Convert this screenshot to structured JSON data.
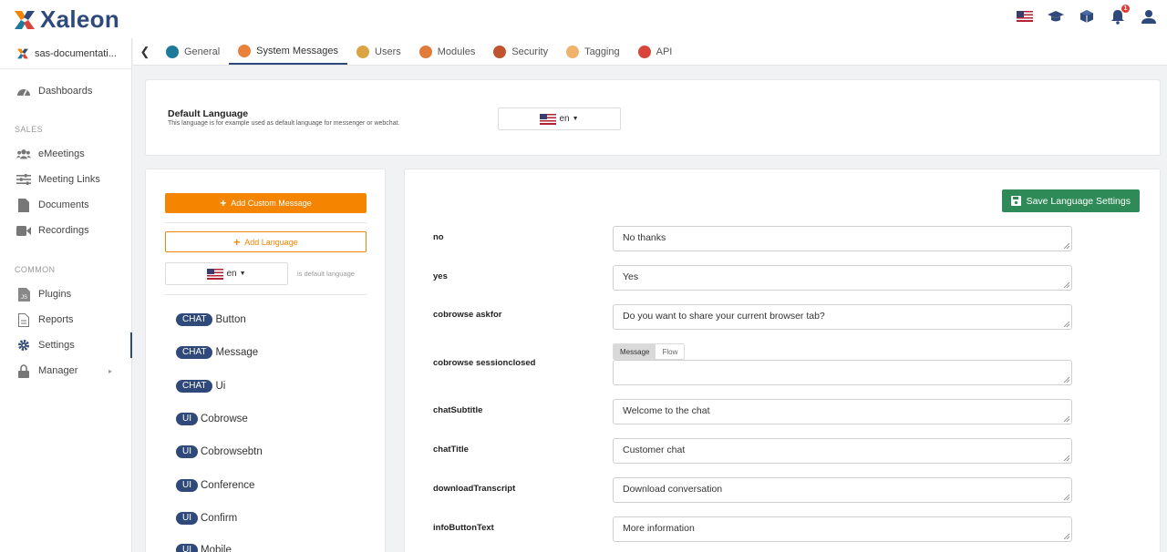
{
  "brand": {
    "name": "Xaleon"
  },
  "topbar": {
    "language_icon": "us-flag-icon",
    "notifications_count": "1"
  },
  "sidebar": {
    "workspace": "sas-documentati...",
    "items": [
      {
        "label": "Dashboards",
        "icon": "dashboard-icon"
      },
      {
        "label": "eMeetings",
        "icon": "users-icon"
      },
      {
        "label": "Meeting Links",
        "icon": "sliders-icon"
      },
      {
        "label": "Documents",
        "icon": "document-icon"
      },
      {
        "label": "Recordings",
        "icon": "video-icon"
      },
      {
        "label": "Plugins",
        "icon": "plugin-icon"
      },
      {
        "label": "Reports",
        "icon": "report-icon"
      },
      {
        "label": "Settings",
        "icon": "gear-icon"
      },
      {
        "label": "Manager",
        "icon": "lock-icon"
      }
    ],
    "sections": {
      "sales": "SALES",
      "common": "COMMON"
    }
  },
  "tabs": [
    {
      "label": "General",
      "color": "#1d7a9a"
    },
    {
      "label": "System Messages",
      "color": "#e8823a"
    },
    {
      "label": "Users",
      "color": "#d9a441"
    },
    {
      "label": "Modules",
      "color": "#e07b39"
    },
    {
      "label": "Security",
      "color": "#c0542f"
    },
    {
      "label": "Tagging",
      "color": "#f0b36b"
    },
    {
      "label": "API",
      "color": "#d8463b"
    }
  ],
  "default_language": {
    "title": "Default Language",
    "description": "This language is for example used as default language for messenger or webchat.",
    "value": "en"
  },
  "left_panel": {
    "add_custom_message": "Add Custom Message",
    "add_language": "Add Language",
    "language_value": "en",
    "default_hint": "is default language",
    "categories": [
      {
        "badge": "CHAT",
        "name": "Button"
      },
      {
        "badge": "CHAT",
        "name": "Message"
      },
      {
        "badge": "CHAT",
        "name": "Ui"
      },
      {
        "badge": "UI",
        "name": "Cobrowse"
      },
      {
        "badge": "UI",
        "name": "Cobrowsebtn"
      },
      {
        "badge": "UI",
        "name": "Conference"
      },
      {
        "badge": "UI",
        "name": "Confirm"
      },
      {
        "badge": "UI",
        "name": "Mobile"
      }
    ]
  },
  "right_panel": {
    "save_label": "Save Language Settings",
    "fields": [
      {
        "key": "no",
        "value": "No thanks"
      },
      {
        "key": "yes",
        "value": "Yes"
      },
      {
        "key": "cobrowse askfor",
        "value": "Do you want to share your current browser tab?"
      },
      {
        "key": "cobrowse sessionclosed",
        "value": ""
      },
      {
        "key": "chatSubtitle",
        "value": "Welcome to the chat"
      },
      {
        "key": "chatTitle",
        "value": "Customer chat"
      },
      {
        "key": "downloadTranscript",
        "value": "Download conversation"
      },
      {
        "key": "infoButtonText",
        "value": "More information"
      }
    ],
    "segment": {
      "message": "Message",
      "flow": "Flow"
    }
  },
  "colors": {
    "accent": "#2f4a7a",
    "orange": "#f58400",
    "green": "#2e8b57"
  }
}
